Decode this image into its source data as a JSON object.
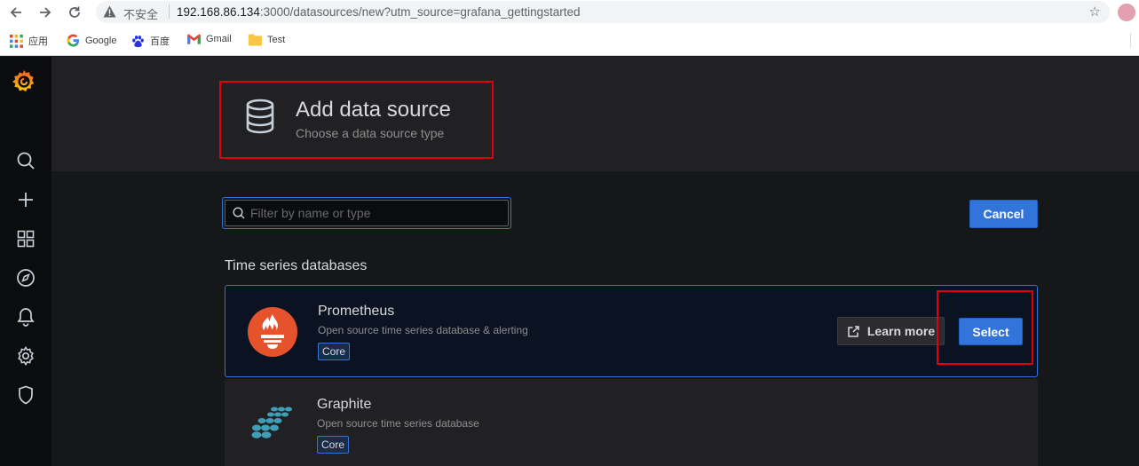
{
  "browser": {
    "security_label": "不安全",
    "url_host": "192.168.86.134",
    "url_rest": ":3000/datasources/new?utm_source=grafana_gettingstarted",
    "bookmarks": [
      {
        "label": "应用",
        "icon": "apps-grid-icon"
      },
      {
        "label": "Google",
        "icon": "google-icon"
      },
      {
        "label": "百度",
        "icon": "baidu-paw-icon"
      },
      {
        "label": "Gmail",
        "icon": "gmail-icon"
      },
      {
        "label": "Test",
        "icon": "folder-icon"
      }
    ]
  },
  "sidemenu": {
    "items": [
      "grafana-logo-icon",
      "search-icon",
      "plus-icon",
      "dashboards-icon",
      "explore-compass-icon",
      "alerting-bell-icon",
      "configuration-gear-icon",
      "server-admin-shield-icon"
    ]
  },
  "header": {
    "title": "Add data source",
    "subtitle": "Choose a data source type",
    "icon": "database-icon"
  },
  "filter": {
    "placeholder": "Filter by name or type",
    "value": ""
  },
  "cancel_label": "Cancel",
  "section_title": "Time series databases",
  "datasources": [
    {
      "name": "Prometheus",
      "description": "Open source time series database & alerting",
      "badge": "Core",
      "learn_more_label": "Learn more",
      "select_label": "Select"
    },
    {
      "name": "Graphite",
      "description": "Open source time series database",
      "badge": "Core"
    }
  ],
  "colors": {
    "primary": "#3274d9",
    "highlight": "#e0000b",
    "prometheus": "#e6522c",
    "graphite": "#3f9fb6"
  }
}
